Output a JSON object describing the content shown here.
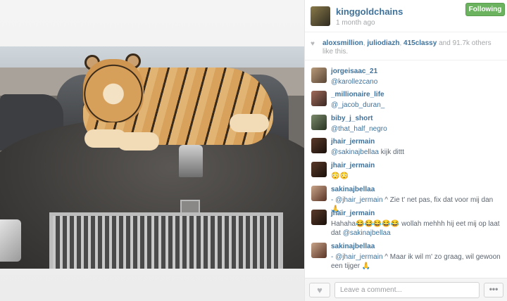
{
  "post": {
    "username": "kinggoldchains",
    "time_ago": "1 month ago",
    "follow_label": "Following"
  },
  "likes": {
    "users": [
      "aloxsmillion",
      "juliodiazh",
      "415classy"
    ],
    "sep1": ", ",
    "sep2": ", ",
    "and_text": " and ",
    "others_count": "91.7k",
    "others_text": " others like this."
  },
  "comments": [
    {
      "user": "jorgeisaac_21",
      "text": "@karollezcano",
      "mention": true
    },
    {
      "user": "_millionaire_life",
      "text": "@_jacob_duran_",
      "mention": true
    },
    {
      "user": "biby_j_short",
      "text": "@that_half_negro",
      "mention": true
    },
    {
      "user": "jhair_jermain",
      "mention_part": "@sakinajbellaa",
      "rest": " kijk dittt"
    },
    {
      "user": "jhair_jermain",
      "text": "😳😳",
      "mention": false
    },
    {
      "user": "sakinajbellaa",
      "mention_part": "- @jhair_jermain",
      "rest": " ^ Zie t' net pas, fix dat voor mij dan 🙏."
    },
    {
      "user": "jhair_jermain",
      "text_pre": "Hahaha😂😂😂😂😂 wollah mehhh hij eet mij op laat dat ",
      "mention_part": "@sakinajbellaa"
    },
    {
      "user": "sakinajbellaa",
      "mention_part": "- @jhair_jermain",
      "rest": " ^ Maar ik wil m' zo graag, wil gewoon een tijger 🙏"
    }
  ],
  "footer": {
    "comment_placeholder": "Leave a comment...",
    "like_icon": "heart-icon",
    "more_icon": "ellipsis-icon",
    "more_label": "•••"
  },
  "icons": {
    "heart_glyph": "♥"
  },
  "colors": {
    "link": "#3f729b",
    "follow_green": "#6bb35e",
    "muted": "#a5a7aa"
  }
}
